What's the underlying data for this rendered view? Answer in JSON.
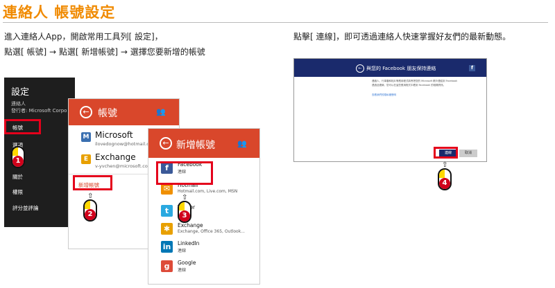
{
  "page_title": "連絡人 帳號設定",
  "instructions": {
    "left_line1": "進入連絡人App，開啟常用工具列[ 設定]，",
    "left_line2": "點選[ 帳號] → 點選[ 新增帳號] → 選擇您要新增的帳號",
    "right_line1": "點擊[ 連線]，即可透過連絡人快速掌握好友們的最新動態。"
  },
  "settings_panel": {
    "title": "設定",
    "app_name": "連絡人",
    "publisher": "發行者: Microsoft Corpo",
    "items": [
      "帳號",
      "選項",
      "關於",
      "權限",
      "評分並評論"
    ]
  },
  "accounts_panel": {
    "title": "帳號",
    "accounts": [
      {
        "name": "Microsoft",
        "email": "ilovedognow@hotmail.com",
        "icon": "microsoft-icon"
      },
      {
        "name": "Exchange",
        "email": "v-yvchen@microsoft.com",
        "icon": "exchange-icon"
      }
    ],
    "add_account": "新增帳號"
  },
  "add_account_panel": {
    "title": "新增帳號",
    "providers": [
      {
        "name": "Facebook",
        "sub": "連線",
        "icon": "facebook-icon",
        "color": "#3b5998",
        "glyph": "f"
      },
      {
        "name": "Hotmail",
        "sub": "Hotmail.com, Live.com, MSN",
        "icon": "hotmail-icon",
        "color": "#f09000",
        "glyph": "✉"
      },
      {
        "name": "Twitter",
        "sub": "",
        "icon": "twitter-icon",
        "color": "#2aa9e0",
        "glyph": "t"
      },
      {
        "name": "Exchange",
        "sub": "Exchange, Office 365, Outlook...",
        "icon": "exchange-icon",
        "color": "#e8a000",
        "glyph": "✱"
      },
      {
        "name": "LinkedIn",
        "sub": "連線",
        "icon": "linkedin-icon",
        "color": "#0077b5",
        "glyph": "in"
      },
      {
        "name": "Google",
        "sub": "連線",
        "icon": "google-icon",
        "color": "#dd4b39",
        "glyph": "g"
      }
    ]
  },
  "facebook_dialog": {
    "title": "與您的 Facebook 朋友保持連絡",
    "body_line1": "連絡人、行事曆和相片等應用程式將會把您的 Microsoft 帳戶連結到 Facebook",
    "body_line2": "透過此連線，您可以在這些應用程式中看到 Facebook 的相關資訊。",
    "link": "查看我們的隱私權聲明",
    "connect_button": "連線",
    "cancel_button": "取消"
  },
  "steps": [
    "1",
    "2",
    "3",
    "4"
  ],
  "colors": {
    "accent": "#f08a00",
    "highlight": "#e4001b",
    "panel_header": "#d9472b",
    "facebook_bar": "#1a2a6c"
  }
}
